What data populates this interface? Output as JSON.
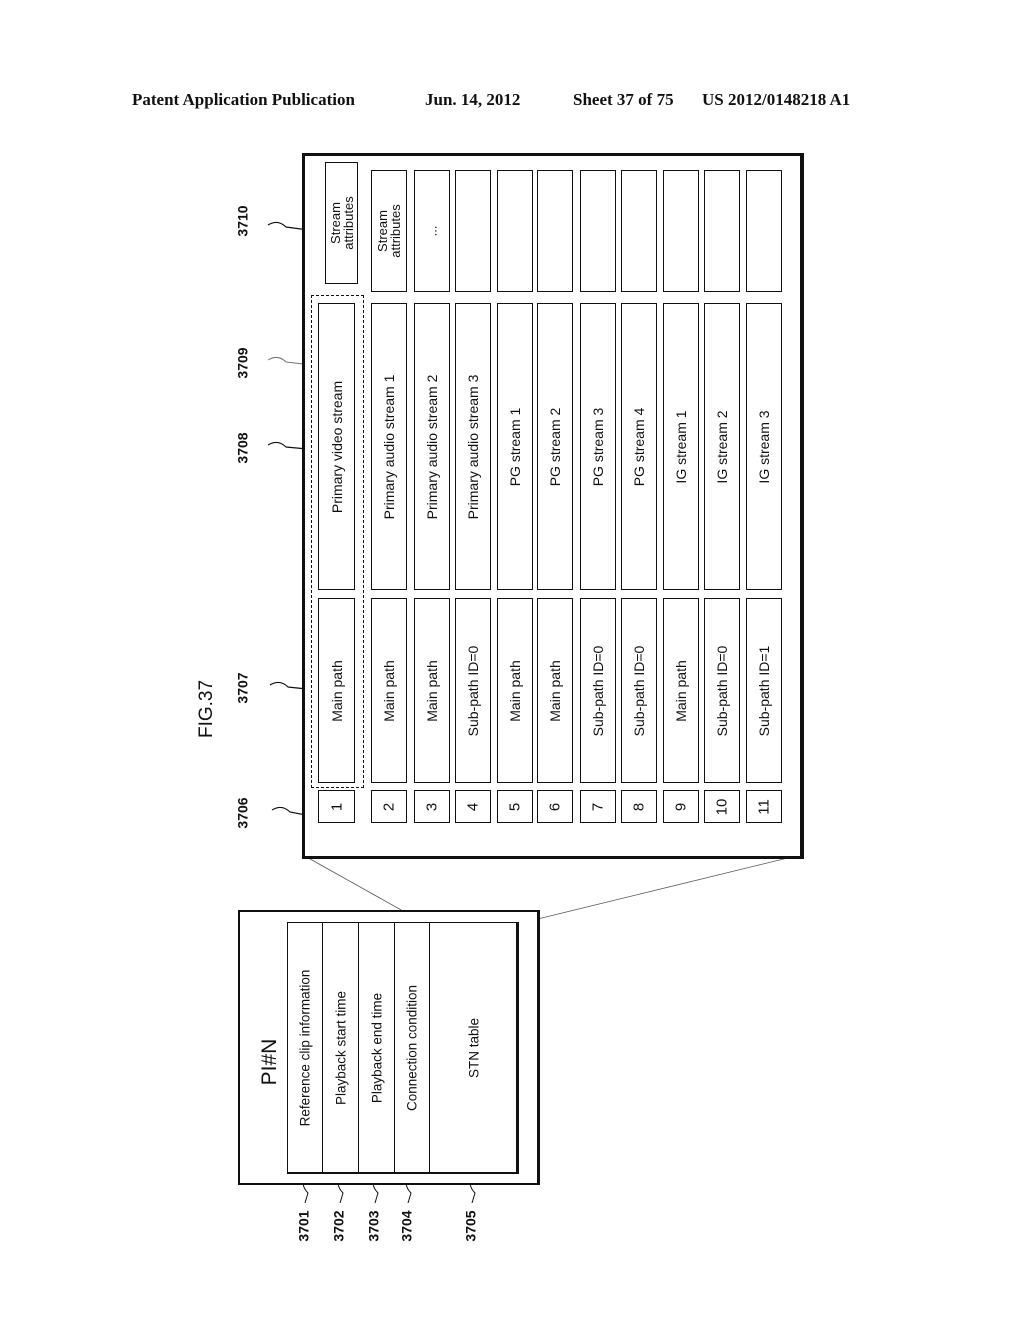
{
  "header": {
    "publication": "Patent Application Publication",
    "date": "Jun. 14, 2012",
    "sheet": "Sheet 37 of 75",
    "patent_number": "US 2012/0148218 A1"
  },
  "figure": {
    "label": "FIG.37",
    "pi_box": {
      "title": "PI#N",
      "fields": [
        {
          "label": "Reference clip information",
          "ref": "3701"
        },
        {
          "label": "Playback start time",
          "ref": "3702"
        },
        {
          "label": "Playback end time",
          "ref": "3703"
        },
        {
          "label": "Connection condition",
          "ref": "3704"
        },
        {
          "label": "STN table",
          "ref": "3705"
        }
      ]
    },
    "stn_table": {
      "refs": {
        "stream_number": "3706",
        "path_info": "3707",
        "stream_id": "3708",
        "entry_group": "3709",
        "attributes": "3710"
      },
      "rows": [
        {
          "number": "1",
          "path": "Main path",
          "stream": "Primary video stream",
          "attributes": "Stream attributes"
        },
        {
          "number": "2",
          "path": "Main path",
          "stream": "Primary audio stream 1",
          "attributes": "Stream attributes"
        },
        {
          "number": "3",
          "path": "Main path",
          "stream": "Primary audio stream 2",
          "attributes": "..."
        },
        {
          "number": "4",
          "path": "Sub-path ID=0",
          "stream": "Primary audio stream 3",
          "attributes": ""
        },
        {
          "number": "5",
          "path": "Main path",
          "stream": "PG stream 1",
          "attributes": ""
        },
        {
          "number": "6",
          "path": "Main path",
          "stream": "PG stream 2",
          "attributes": ""
        },
        {
          "number": "7",
          "path": "Sub-path ID=0",
          "stream": "PG stream 3",
          "attributes": ""
        },
        {
          "number": "8",
          "path": "Sub-path ID=0",
          "stream": "PG stream 4",
          "attributes": ""
        },
        {
          "number": "9",
          "path": "Main path",
          "stream": "IG stream 1",
          "attributes": ""
        },
        {
          "number": "10",
          "path": "Sub-path ID=0",
          "stream": "IG stream 2",
          "attributes": ""
        },
        {
          "number": "11",
          "path": "Sub-path ID=1",
          "stream": "IG stream 3",
          "attributes": ""
        }
      ]
    }
  }
}
